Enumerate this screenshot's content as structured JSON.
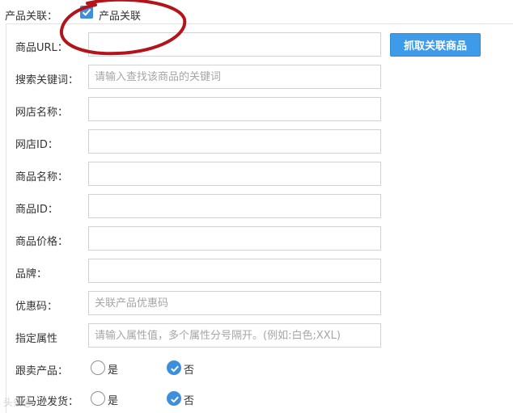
{
  "product_link": {
    "label": "产品关联：",
    "checkbox_label": "产品关联",
    "checked": true
  },
  "fields": {
    "url": {
      "label": "商品URL：",
      "value": "",
      "placeholder": ""
    },
    "keyword": {
      "label": "搜索关键词：",
      "value": "",
      "placeholder": "请输入查找该商品的关键词"
    },
    "shop_name": {
      "label": "网店名称：",
      "value": "",
      "placeholder": ""
    },
    "shop_id": {
      "label": "网店ID：",
      "value": "",
      "placeholder": ""
    },
    "product_name": {
      "label": "商品名称：",
      "value": "",
      "placeholder": ""
    },
    "product_id": {
      "label": "商品ID：",
      "value": "",
      "placeholder": ""
    },
    "product_price": {
      "label": "商品价格：",
      "value": "",
      "placeholder": ""
    },
    "brand": {
      "label": "品牌：",
      "value": "",
      "placeholder": ""
    },
    "coupon": {
      "label": "优惠码：",
      "value": "",
      "placeholder": "关联产品优惠码"
    },
    "attributes": {
      "label": "指定属性",
      "value": "",
      "placeholder": "请输入属性值，多个属性分号隔开。(例如:白色;XXL)"
    }
  },
  "fetch_button_label": "抓取关联商品",
  "radios": {
    "follow_sell": {
      "label": "跟卖产品：",
      "options": [
        "是",
        "否"
      ],
      "selected": "否"
    },
    "amazon_fulfill": {
      "label": "亚马逊发货：",
      "options": [
        "是",
        "否"
      ],
      "selected": "否"
    }
  },
  "watermark": "头条@",
  "colors": {
    "accent": "#3d8fdc",
    "button": "#3d9be9",
    "annotation": "#b3131b"
  }
}
